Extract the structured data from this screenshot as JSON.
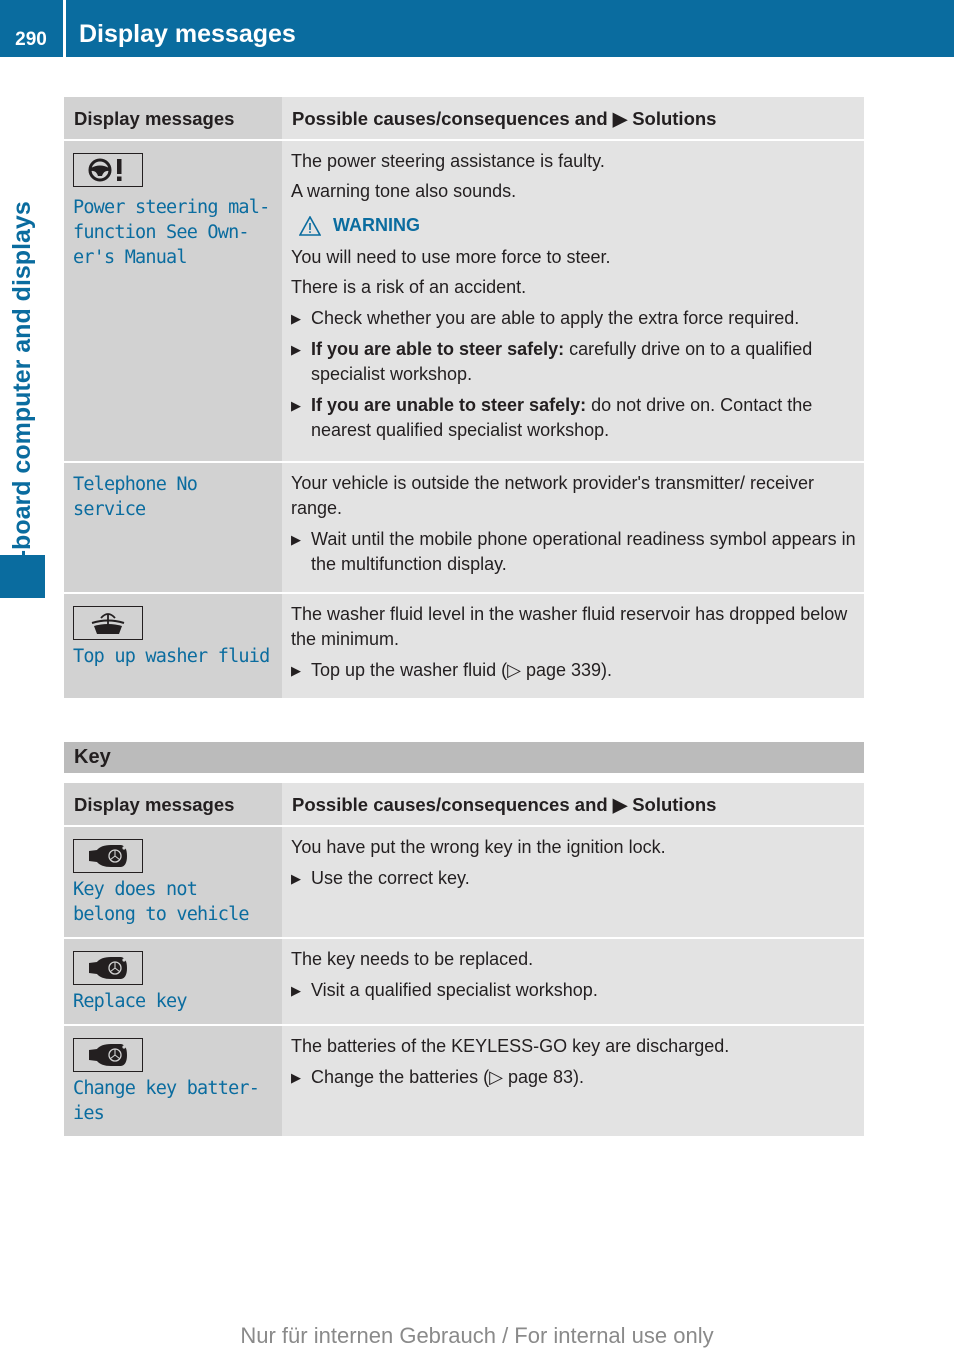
{
  "header": {
    "page_number": "290",
    "title": "Display messages",
    "side_tab": "On-board computer and displays"
  },
  "table1": {
    "col_headers": [
      "Display messages",
      "Possible causes/consequences and",
      "Solutions"
    ],
    "rows": [
      {
        "icon": "power-steering-warning-icon",
        "message": "Power steering mal-function See Own-er's Manual",
        "message_lines": [
          "Power steering mal-",
          "function See Own-",
          "er's Manual"
        ],
        "paragraphs": [
          "The power steering assistance is faulty.",
          "A warning tone also sounds."
        ],
        "warning": {
          "label": "WARNING",
          "lines": [
            "You will need to use more force to steer.",
            "There is a risk of an accident."
          ]
        },
        "bullets": [
          {
            "bold": "",
            "text": "Check whether you are able to apply the extra force required."
          },
          {
            "bold": "If you are able to steer safely:",
            "text": " carefully drive on to a qualified specialist workshop."
          },
          {
            "bold": "If you are unable to steer safely:",
            "text": " do not drive on. Contact the nearest qualified specialist workshop."
          }
        ]
      },
      {
        "icon": "",
        "message_lines": [
          "Telephone No",
          "service"
        ],
        "paragraphs": [
          "Your vehicle is outside the network provider's transmitter/ receiver range."
        ],
        "bullets": [
          {
            "bold": "",
            "text": "Wait until the mobile phone operational readiness symbol appears in the multifunction display."
          }
        ]
      },
      {
        "icon": "washer-fluid-icon",
        "message_lines": [
          "Top up washer fluid"
        ],
        "paragraphs": [
          "The washer fluid level in the washer fluid reservoir has dropped below the minimum."
        ],
        "bullets": [
          {
            "bold": "",
            "text": "Top up the washer fluid (▷ page 339)."
          }
        ]
      }
    ]
  },
  "key_section": {
    "title": "Key",
    "col_headers": [
      "Display messages",
      "Possible causes/consequences and",
      "Solutions"
    ],
    "rows": [
      {
        "icon": "key-icon",
        "message_lines": [
          "Key does not",
          "belong to vehicle"
        ],
        "paragraphs": [
          "You have put the wrong key in the ignition lock."
        ],
        "bullets": [
          {
            "bold": "",
            "text": "Use the correct key."
          }
        ]
      },
      {
        "icon": "key-icon",
        "message_lines": [
          "Replace key"
        ],
        "paragraphs": [
          "The key needs to be replaced."
        ],
        "bullets": [
          {
            "bold": "",
            "text": "Visit a qualified specialist workshop."
          }
        ]
      },
      {
        "icon": "key-icon",
        "message_lines": [
          "Change key batter-",
          "ies"
        ],
        "paragraphs": [
          "The batteries of the KEYLESS-GO key are discharged."
        ],
        "bullets": [
          {
            "bold": "",
            "text": "Change the batteries (▷ page 83)."
          }
        ]
      }
    ]
  },
  "footer": "Nur für internen Gebrauch / For internal use only",
  "colors": {
    "brand_blue": "#0a6c9f",
    "col1_bg": "#d2d2d2",
    "col2_bg": "#e3e3e3",
    "section_bar": "#bbbbbb"
  }
}
